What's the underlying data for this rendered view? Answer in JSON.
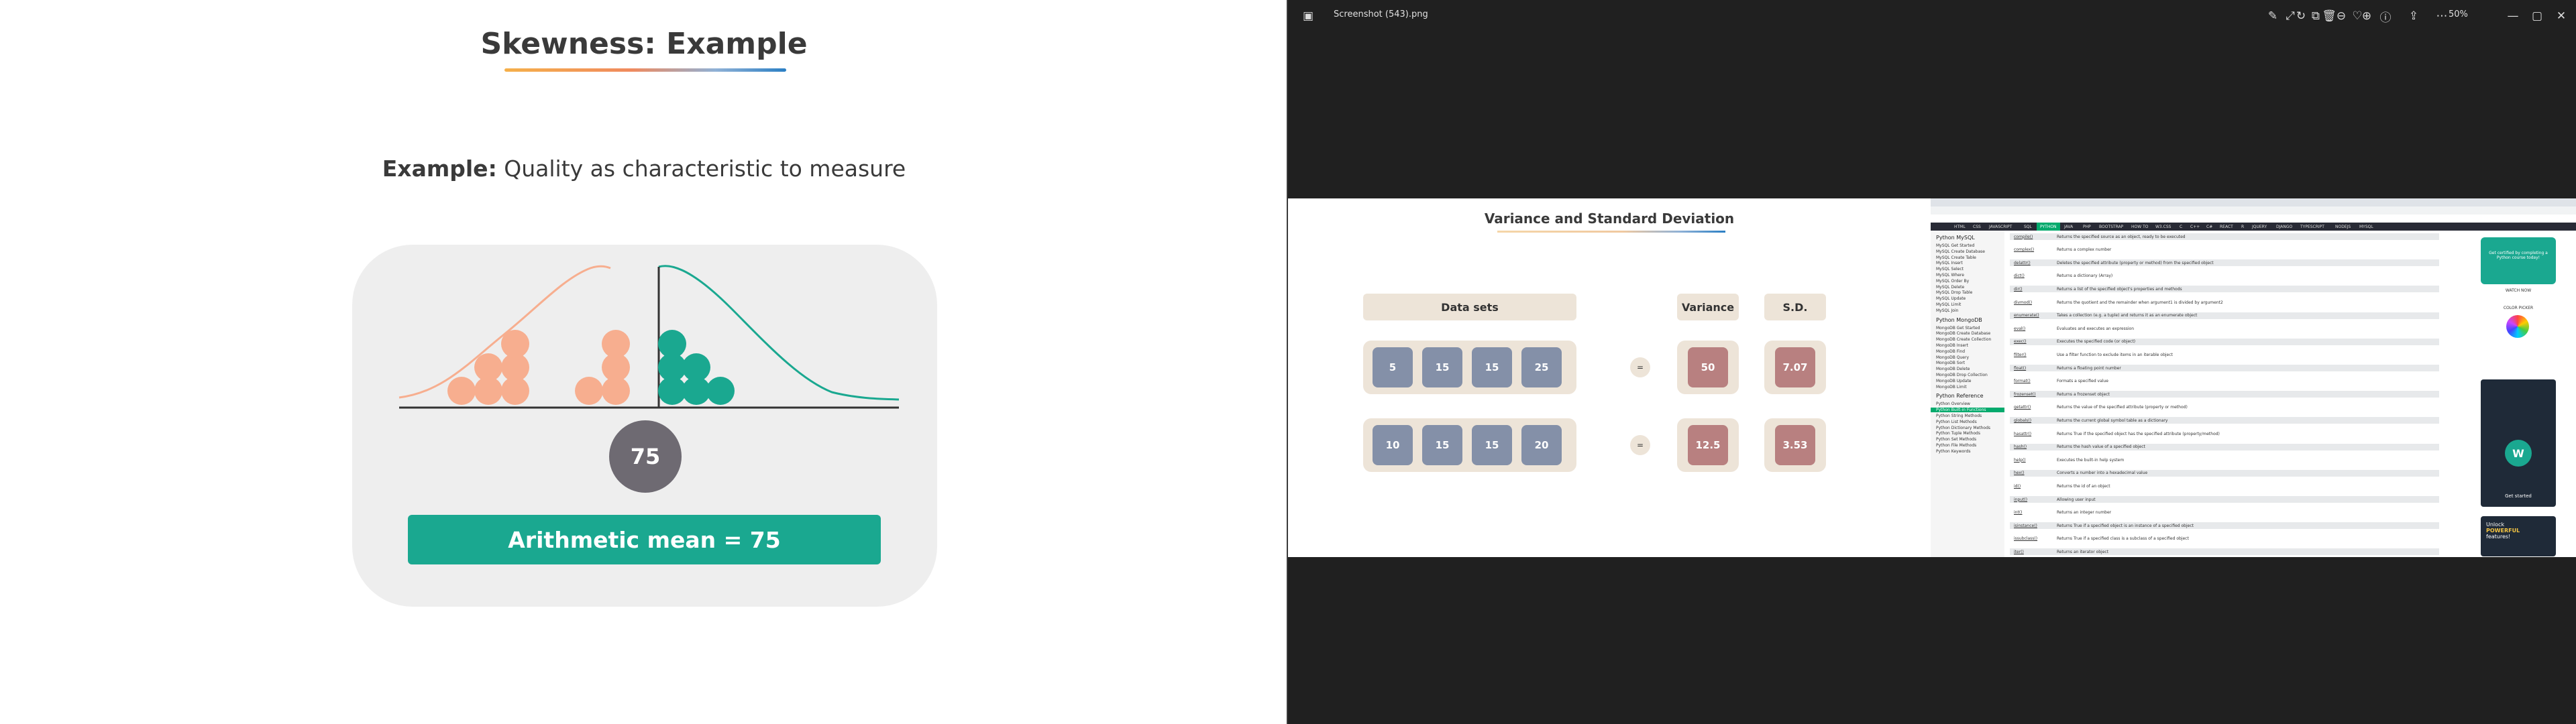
{
  "slide": {
    "title": "Skewness: Example",
    "example_bold": "Example:",
    "example_text": " Quality as characteristic to measure",
    "mean_circle": "75",
    "mean_bar": "Arithmetic mean = 75"
  },
  "viewer": {
    "filename": "Screenshot (543).png",
    "zoom": "50%"
  },
  "photo_slide": {
    "title": "Variance and Standard Deviation",
    "headers": {
      "data_sets": "Data sets",
      "variance": "Variance",
      "sd": "S.D."
    },
    "rows": [
      {
        "values": [
          "5",
          "15",
          "15",
          "25"
        ],
        "eq": "=",
        "variance": "50",
        "sd": "7.07"
      },
      {
        "values": [
          "10",
          "15",
          "15",
          "20"
        ],
        "eq": "=",
        "variance": "12.5",
        "sd": "3.53"
      }
    ]
  },
  "browser": {
    "nav": [
      "HTML",
      "CSS",
      "JAVASCRIPT",
      "SQL",
      "PYTHON",
      "JAVA",
      "PHP",
      "BOOTSTRAP",
      "HOW TO",
      "W3.CSS",
      "C",
      "C++",
      "C#",
      "REACT",
      "R",
      "JQUERY",
      "DJANGO",
      "TYPESCRIPT",
      "NODEJS",
      "MYSQL"
    ],
    "side": [
      {
        "h": "Python MySQL"
      },
      "MySQL Get Started",
      "MySQL Create Database",
      "MySQL Create Table",
      "MySQL Insert",
      "MySQL Select",
      "MySQL Where",
      "MySQL Order By",
      "MySQL Delete",
      "MySQL Drop Table",
      "MySQL Update",
      "MySQL Limit",
      "MySQL Join",
      {
        "h": "Python MongoDB"
      },
      "MongoDB Get Started",
      "MongoDB Create Database",
      "MongoDB Create Collection",
      "MongoDB Insert",
      "MongoDB Find",
      "MongoDB Query",
      "MongoDB Sort",
      "MongoDB Delete",
      "MongoDB Drop Collection",
      "MongoDB Update",
      "MongoDB Limit",
      {
        "h": "Python Reference"
      },
      "Python Overview",
      "Python Built-in Functions",
      "Python String Methods",
      "Python List Methods",
      "Python Dictionary Methods",
      "Python Tuple Methods",
      "Python Set Methods",
      "Python File Methods",
      "Python Keywords"
    ],
    "functions": [
      [
        "compile()",
        "Returns the specified source as an object, ready to be executed"
      ],
      [
        "complex()",
        "Returns a complex number"
      ],
      [
        "delattr()",
        "Deletes the specified attribute (property or method) from the specified object"
      ],
      [
        "dict()",
        "Returns a dictionary (Array)"
      ],
      [
        "dir()",
        "Returns a list of the specified object's properties and methods"
      ],
      [
        "divmod()",
        "Returns the quotient and the remainder when argument1 is divided by argument2"
      ],
      [
        "enumerate()",
        "Takes a collection (e.g. a tuple) and returns it as an enumerate object"
      ],
      [
        "eval()",
        "Evaluates and executes an expression"
      ],
      [
        "exec()",
        "Executes the specified code (or object)"
      ],
      [
        "filter()",
        "Use a filter function to exclude items in an iterable object"
      ],
      [
        "float()",
        "Returns a floating point number"
      ],
      [
        "format()",
        "Formats a specified value"
      ],
      [
        "frozenset()",
        "Returns a frozenset object"
      ],
      [
        "getattr()",
        "Returns the value of the specified attribute (property or method)"
      ],
      [
        "globals()",
        "Returns the current global symbol table as a dictionary"
      ],
      [
        "hasattr()",
        "Returns True if the specified object has the specified attribute (property/method)"
      ],
      [
        "hash()",
        "Returns the hash value of a specified object"
      ],
      [
        "help()",
        "Executes the built-in help system"
      ],
      [
        "hex()",
        "Converts a number into a hexadecimal value"
      ],
      [
        "id()",
        "Returns the id of an object"
      ],
      [
        "input()",
        "Allowing user input"
      ],
      [
        "int()",
        "Returns an integer number"
      ],
      [
        "isinstance()",
        "Returns True if a specified object is an instance of a specified object"
      ],
      [
        "issubclass()",
        "Returns True if a specified class is a subclass of a specified object"
      ],
      [
        "iter()",
        "Returns an iterator object"
      ]
    ],
    "ad": {
      "text1": "Get certified by completing a Python course today!",
      "watch": "WATCH NOW",
      "color_picker": "COLOR PICKER",
      "get_started": "Get started",
      "unlock": "Unlock",
      "powerful": "POWERFUL",
      "features": "features!"
    }
  },
  "colors": {
    "skew_left": "#f7ae8f",
    "skew_right": "#1aa890",
    "mean_bar": "#1aa890",
    "mean_circle": "#6e6a72"
  }
}
